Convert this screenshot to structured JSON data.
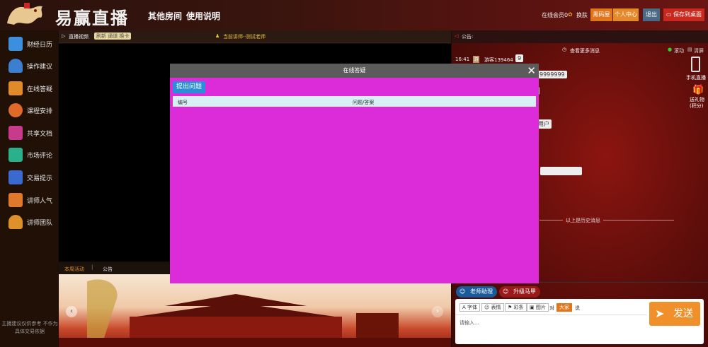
{
  "header": {
    "site_name": "易赢直播",
    "nav": [
      "其他房间",
      "使用说明"
    ],
    "member_text": "在线会员0",
    "skin_label": "换肤",
    "vip_button": "黑码屋",
    "profile_button": "个人中心",
    "logout_button": "退出",
    "save_desktop_button": "保存到桌面"
  },
  "sidebar": {
    "items": [
      {
        "label": "财经日历",
        "icon": "calendar-icon",
        "color": "#3c8fdc"
      },
      {
        "label": "操作建议",
        "icon": "bell-icon",
        "color": "#3a7fd0"
      },
      {
        "label": "在线答疑",
        "icon": "document-icon",
        "color": "#e08a2a"
      },
      {
        "label": "课程安排",
        "icon": "person-chart-icon",
        "color": "#e06a2a"
      },
      {
        "label": "共享文档",
        "icon": "trend-icon",
        "color": "#c83a8c"
      },
      {
        "label": "市场评论",
        "icon": "books-icon",
        "color": "#2ab08a"
      },
      {
        "label": "交易提示",
        "icon": "mail-icon",
        "color": "#3a6ad0"
      },
      {
        "label": "讲师人气",
        "icon": "thumbs-up-icon",
        "color": "#e07a2a"
      },
      {
        "label": "讲师团队",
        "icon": "user-icon",
        "color": "#e0902a"
      }
    ],
    "disclaimer": "主播建议仅供参考 不作为具体交易依据"
  },
  "video": {
    "live_label": "直播视频",
    "refresh_label": "刷新 通道 换卡",
    "current_teacher_label": "当前讲师--",
    "current_teacher_name": "测试老师"
  },
  "bottom_tabs": [
    "本周活动",
    "公告"
  ],
  "chat": {
    "announcement_label": "公告:",
    "more_messages": "查看更多消息",
    "scroll_label": "滚动",
    "clear_label": "清屏",
    "msg_time": "16:41",
    "msg_user": "游客139464",
    "msg_badge": "9",
    "bubble_1": "9999999",
    "bubble_2": "用户",
    "history_label": "以上是历史消息",
    "mobile_label": "手机直播",
    "gift_label": "送礼物(积分)",
    "assistant_button": "老师助理",
    "upgrade_button": "升级马甲",
    "toolbar": [
      "字体",
      "表情",
      "彩条",
      "图片"
    ],
    "to_label": "对",
    "to_target": "大家",
    "say_label": "说",
    "input_placeholder": "请输入...",
    "send_button": "发送"
  },
  "modal": {
    "title": "在线答疑",
    "ask_button": "提出问题",
    "columns": [
      "编号",
      "问题/答案"
    ]
  },
  "colors": {
    "modal_bg": "#dc2cd9",
    "send_button": "#f0902a",
    "ask_button": "#2a8fd8"
  }
}
